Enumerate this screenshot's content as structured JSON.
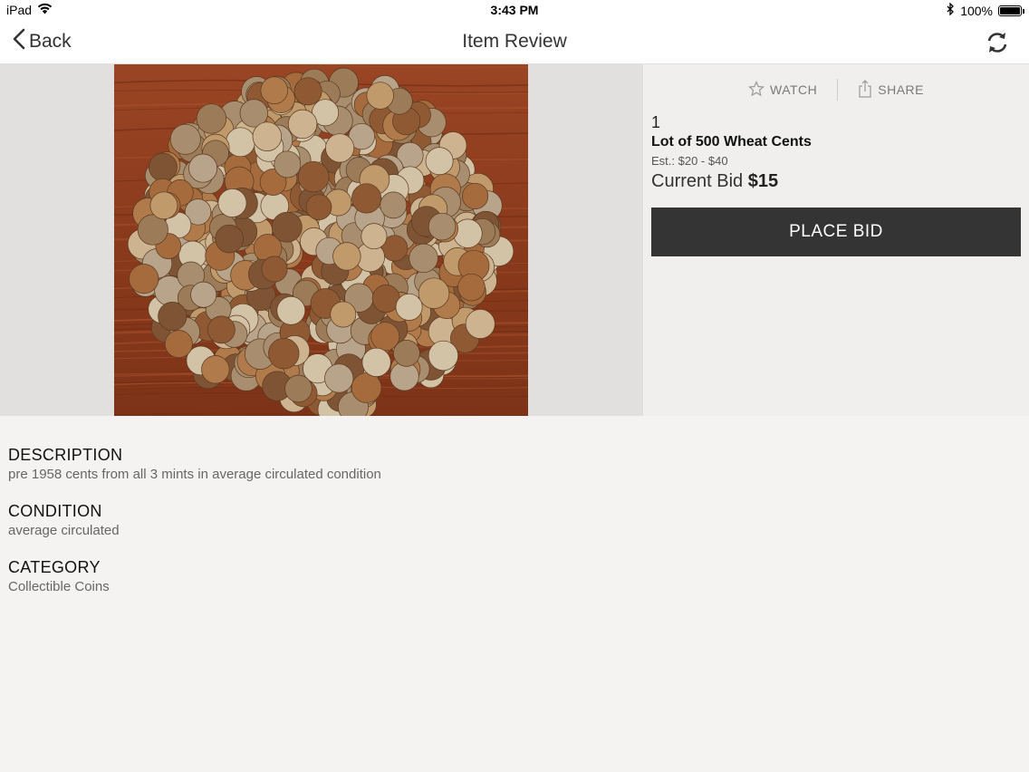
{
  "status_bar": {
    "device": "iPad",
    "time": "3:43 PM",
    "battery": "100%",
    "battery_level": 1.0
  },
  "nav": {
    "back_label": "Back",
    "title": "Item Review"
  },
  "actions": {
    "watch_label": "WATCH",
    "share_label": "SHARE"
  },
  "item": {
    "lot_number": "1",
    "title": "Lot of 500 Wheat Cents",
    "estimate": "Est.: $20 - $40",
    "current_bid_label": "Current Bid",
    "current_bid_value": "$15",
    "place_bid_label": "PLACE BID"
  },
  "details": {
    "description_heading": "DESCRIPTION",
    "description_text": "pre 1958 cents from all 3 mints in average circulated condition",
    "condition_heading": "CONDITION",
    "condition_text": "average circulated",
    "category_heading": "CATEGORY",
    "category_text": "Collectible Coins"
  },
  "colors": {
    "button_bg": "#343434",
    "page_bg": "#f5f3f1",
    "wood": "#8a3a1c"
  }
}
